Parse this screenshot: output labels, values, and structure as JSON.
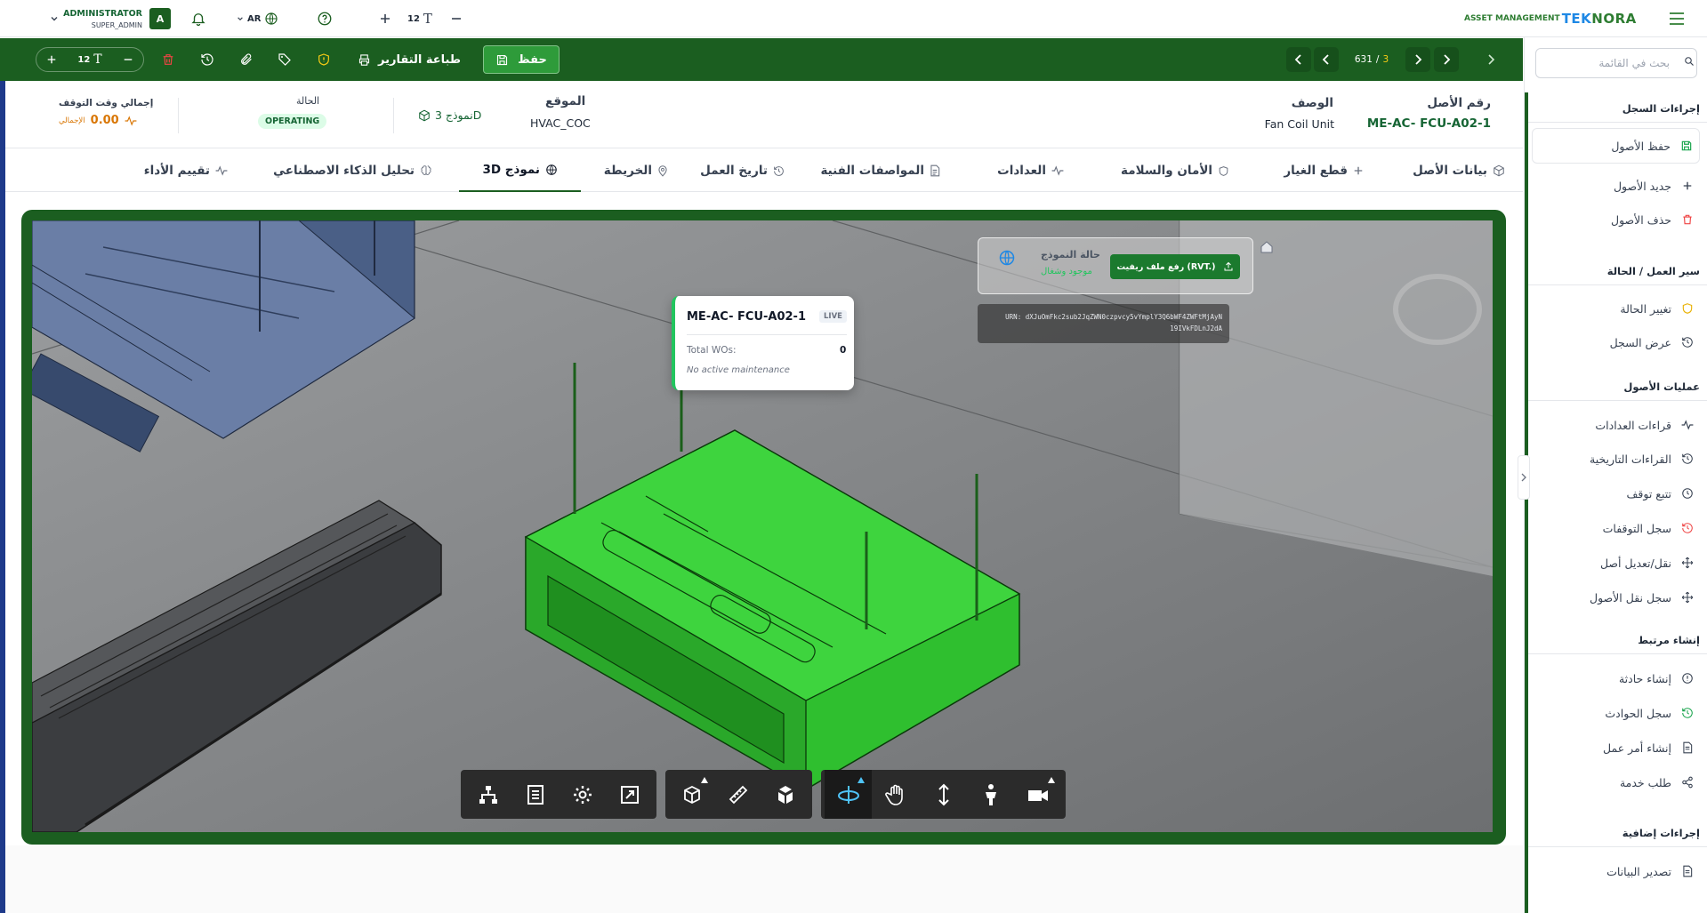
{
  "topbar": {
    "user_name": "ADMINISTRATOR",
    "user_role": "SUPER_ADMIN",
    "avatar_letter": "A",
    "language": "AR",
    "font_size": "12",
    "brand_prefix": "ASSET MANAGEMENT",
    "brand_logo_a": "TEK",
    "brand_logo_b": "NORA",
    "brand_color": "#2e7d32",
    "logo_blue": "#1e88e5"
  },
  "sidebar": {
    "search_placeholder": "بحث في القائمة",
    "sections": [
      {
        "title": "إجراءات السجل",
        "items": [
          {
            "label": "حفظ الأصول",
            "icon": "save-icon"
          },
          {
            "label": "جديد الأصول",
            "icon": "plus-icon"
          },
          {
            "label": "حذف الأصول",
            "icon": "trash-icon"
          }
        ]
      },
      {
        "title": "سير العمل / الحالة",
        "items": [
          {
            "label": "تغيير الحالة",
            "icon": "shield-icon"
          },
          {
            "label": "عرض السجل",
            "icon": "history-icon"
          }
        ]
      },
      {
        "title": "عمليات الأصول",
        "items": [
          {
            "label": "قراءات العدادات",
            "icon": "activity-icon"
          },
          {
            "label": "القراءات التاريخية",
            "icon": "history-icon"
          },
          {
            "label": "تتبع توقف",
            "icon": "clock-icon"
          },
          {
            "label": "سجل التوقفات",
            "icon": "history-red-icon"
          },
          {
            "label": "نقل/تعديل أصل",
            "icon": "move-icon"
          },
          {
            "label": "سجل نقل الأصول",
            "icon": "move-icon"
          }
        ]
      },
      {
        "title": "إنشاء مرتبط",
        "items": [
          {
            "label": "إنشاء حادثة",
            "icon": "alert-icon"
          },
          {
            "label": "سجل الحوادث",
            "icon": "history-green-icon"
          },
          {
            "label": "إنشاء أمر عمل",
            "icon": "document-icon"
          },
          {
            "label": "طلب خدمة",
            "icon": "share-icon"
          }
        ]
      },
      {
        "title": "إجراءات إضافية",
        "items": [
          {
            "label": "تصدير البيانات",
            "icon": "document-icon"
          }
        ]
      }
    ]
  },
  "toolbar": {
    "font_size": "12",
    "print_label": "طباعة التقارير",
    "save_label": "حفظ",
    "record_current": "631",
    "record_sep": "/",
    "record_total": "3"
  },
  "info": {
    "asset_number_label": "رقم الأصل",
    "asset_number": "ME-AC- FCU-A02-1",
    "description_label": "الوصف",
    "description": "Fan Coil Unit",
    "location_label": "الموقع",
    "location": "HVAC_COC",
    "model_link": "نموذج 3D",
    "status_label": "الحالة",
    "status": "OPERATING",
    "downtime_label": "إجمالي وقت التوقف",
    "downtime_value": "0.00",
    "downtime_unit": "الإجمالي"
  },
  "tabs": [
    {
      "label": "بيانات الأصل",
      "icon": "cube-icon"
    },
    {
      "label": "قطع الغيار",
      "icon": "plus-icon"
    },
    {
      "label": "الأمان والسلامة",
      "icon": "shield-icon"
    },
    {
      "label": "العدادات",
      "icon": "activity-icon"
    },
    {
      "label": "المواصفات الفنية",
      "icon": "document-icon"
    },
    {
      "label": "تاريخ العمل",
      "icon": "history-icon"
    },
    {
      "label": "الخريطة",
      "icon": "pin-icon"
    },
    {
      "label": "نموذج 3D",
      "icon": "globe-icon"
    },
    {
      "label": "تحليل الذكاء الاصطناعي",
      "icon": "brain-icon"
    },
    {
      "label": "تقييم الأداء",
      "icon": "activity-icon"
    }
  ],
  "active_tab": "نموذج 3D",
  "viewer": {
    "model_status_label": "حالة النموذج",
    "model_status_value": "موجود وشغال",
    "upload_label": "رفع ملف ريفيت (RVT.)",
    "urn_text": "URN: dXJuOmFkc2sub2JqZWN0czpvcy5vYmplY3Q6bWF4ZWFtMjAyN",
    "urn_text_2": "19IVkFDLnJ2dA",
    "tooltip_title": "ME-AC- FCU-A02-1",
    "tooltip_badge": "LIVE",
    "tooltip_metric_label": "Total WOs:",
    "tooltip_metric_value": "0",
    "tooltip_note": "No active maintenance",
    "highlight_color": "#22c55e"
  },
  "viewer_tools": [
    [
      "model-browser-icon",
      "properties-icon",
      "settings-icon",
      "fullscreen-icon"
    ],
    [
      "section-box-icon",
      "measure-icon",
      "explode-icon"
    ],
    [
      "orbit-icon",
      "pan-icon",
      "zoom-icon",
      "first-person-icon",
      "camera-icon"
    ]
  ]
}
